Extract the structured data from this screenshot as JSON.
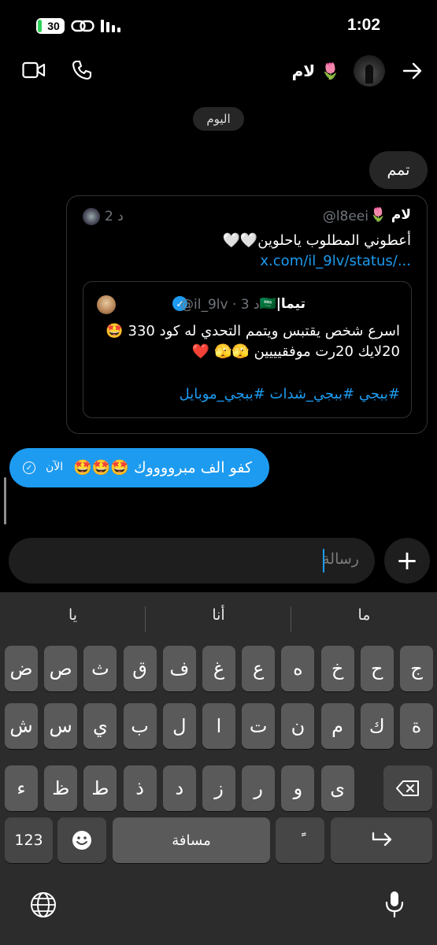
{
  "status_bar": {
    "battery": "30",
    "time": "1:02"
  },
  "header": {
    "contact_name": "لام 🌷",
    "back_icon": "arrow-right-icon",
    "call_icon": "phone-icon",
    "video_icon": "video-camera-icon"
  },
  "date_label": "اليوم",
  "messages": {
    "msg1": "تمم",
    "tweet": {
      "name": "لام 🌷",
      "handle": "@l8eei",
      "time": "2 د",
      "text": "أعطوني المطلوب ياحلوين🤍🤍 ",
      "link": "x.com/il_9lv/status/...",
      "quote": {
        "name": "تيما|🇸🇦",
        "handle": "@il_9lv",
        "time": "3 د",
        "text_line1": "اسرع شخص يقتبس ويتمم التحدي له كود 330 🤩",
        "text_line2": "20لايك        20رت         موفقيييين 🫣🫣 ❤️",
        "hashtags": "#ببجي #ببجي_شدات #ببجي_موبايل"
      }
    },
    "msg3": {
      "text": "كفو الف مبرووووك 🤩🤩🤩",
      "time": "الآن",
      "status": "sent"
    }
  },
  "input": {
    "placeholder": "رسالة",
    "plus_icon": "plus-icon"
  },
  "keyboard": {
    "suggestions": [
      "ما",
      "أنا",
      "يا"
    ],
    "row1": [
      "ض",
      "ص",
      "ث",
      "ق",
      "ف",
      "غ",
      "ع",
      "ه",
      "خ",
      "ح",
      "ج"
    ],
    "row2": [
      "ش",
      "س",
      "ي",
      "ب",
      "ل",
      "ا",
      "ت",
      "ن",
      "م",
      "ك",
      "ة"
    ],
    "row3": [
      "ء",
      "ظ",
      "ط",
      "ذ",
      "د",
      "ز",
      "ر",
      "و",
      "ى"
    ],
    "numbers_label": "123",
    "space_label": "مسافة",
    "tanween_label": "ًً",
    "emoji_icon": "emoji-icon",
    "backspace_icon": "backspace-icon",
    "return_icon": "return-icon",
    "globe_icon": "globe-icon",
    "mic_icon": "microphone-icon"
  }
}
